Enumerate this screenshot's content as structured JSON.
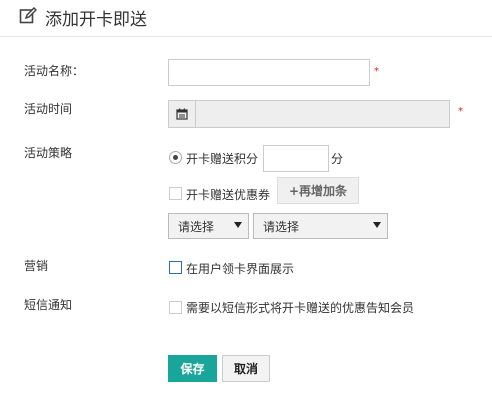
{
  "header": {
    "title": "添加开卡即送",
    "icon": "edit-icon"
  },
  "form": {
    "name_label": "活动名称：",
    "time_label": "活动时间",
    "strategy_label": "活动策略",
    "marketing_label": "营销",
    "sms_label": "短信通知",
    "required_mark": "*",
    "name_value": "",
    "time_value": "",
    "calendar_icon": "calendar-icon"
  },
  "strategy": {
    "points_option": "开卡赠送积分",
    "points_value": "",
    "points_unit": "分",
    "points_selected": true,
    "coupon_option": "开卡赠送优惠券",
    "coupon_checked": false,
    "add_button": "+再增加条",
    "select1": "请选择",
    "select2": "请选择"
  },
  "marketing": {
    "option": "在用户领卡界面展示",
    "checked": false
  },
  "sms": {
    "option": "需要以短信形式将开卡赠送的优惠告知会员",
    "checked": false
  },
  "actions": {
    "save": "保存",
    "cancel": "取消"
  },
  "colors": {
    "accent": "#1aa59a",
    "required": "#e02020",
    "checkbox_blue": "#2e6ea6"
  }
}
